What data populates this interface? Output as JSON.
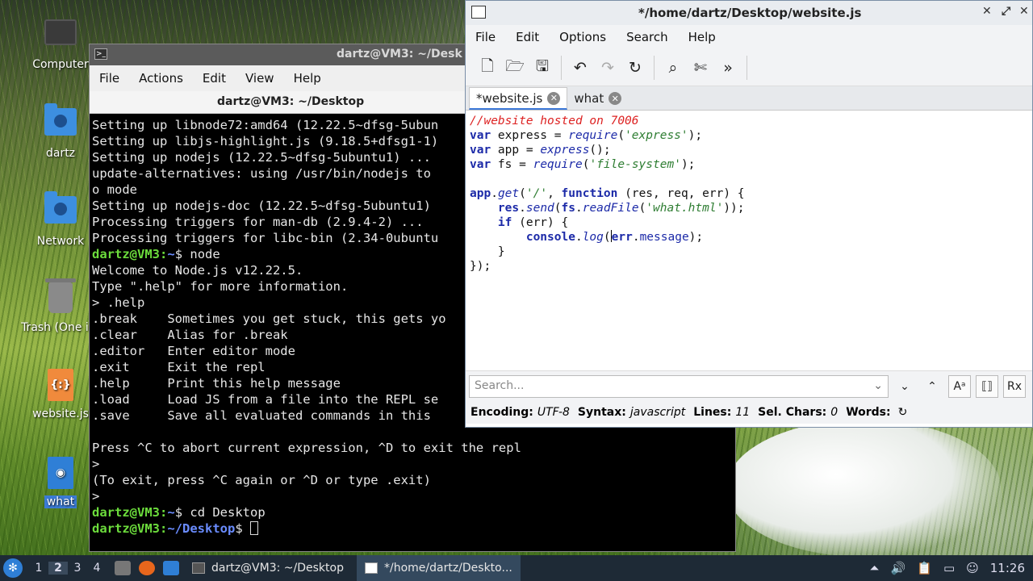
{
  "desktop": {
    "icons": [
      {
        "label": "Computer",
        "icon": "computer-icon"
      },
      {
        "label": "dartz",
        "icon": "home-folder-icon"
      },
      {
        "label": "Network",
        "icon": "network-icon"
      },
      {
        "label": "Trash (One ite",
        "icon": "trash-icon"
      },
      {
        "label": "website.js",
        "icon": "js-file-icon"
      },
      {
        "label": "what",
        "icon": "html-file-icon"
      }
    ]
  },
  "terminal": {
    "title": "dartz@VM3: ~/Desk",
    "tab_title": "dartz@VM3: ~/Desktop",
    "menu": [
      "File",
      "Actions",
      "Edit",
      "View",
      "Help"
    ],
    "lines": [
      "Setting up libnode72:amd64 (12.22.5~dfsg-5ubun",
      "Setting up libjs-highlight.js (9.18.5+dfsg1-1)",
      "Setting up nodejs (12.22.5~dfsg-5ubuntu1) ...",
      "update-alternatives: using /usr/bin/nodejs to ",
      "o mode",
      "Setting up nodejs-doc (12.22.5~dfsg-5ubuntu1)",
      "Processing triggers for man-db (2.9.4-2) ...",
      "Processing triggers for libc-bin (2.34-0ubuntu"
    ],
    "prompt_user": "dartz@VM3",
    "prompt_home": "~",
    "prompt_desktop": "~/Desktop",
    "cmd_node": "node",
    "node_lines": [
      "Welcome to Node.js v12.22.5.",
      "Type \".help\" for more information.",
      "> .help",
      ".break    Sometimes you get stuck, this gets yo",
      ".clear    Alias for .break",
      ".editor   Enter editor mode",
      ".exit     Exit the repl",
      ".help     Print this help message",
      ".load     Load JS from a file into the REPL se",
      ".save     Save all evaluated commands in this ",
      "",
      "Press ^C to abort current expression, ^D to exit the repl",
      ">",
      "(To exit, press ^C again or ^D or type .exit)",
      ">"
    ],
    "cmd_cd": "cd Desktop"
  },
  "editor": {
    "title": "*/home/dartz/Desktop/website.js",
    "menu": [
      "File",
      "Edit",
      "Options",
      "Search",
      "Help"
    ],
    "tabs": [
      "*website.js",
      "what"
    ],
    "code": {
      "l1": "//website hosted on 7006",
      "var": "var",
      "express_name": " express = ",
      "require": "require",
      "s_express": "'express'",
      "app_name": " app = ",
      "express_call": "express",
      "fs_name": " fs = ",
      "s_fs": "'file-system'",
      "app": "app",
      "get": "get",
      "s_root": "'/'",
      "function": "function",
      "args": " (res, req, err) {",
      "res": "res",
      "send": "send",
      "fs": "fs",
      "readFile": "readFile",
      "s_what": "'what.html'",
      "if": "if",
      "if_rest": " (err) {",
      "console": "console",
      "log": "log",
      "err": "err",
      "message": "message"
    },
    "search_placeholder": "Search...",
    "status": {
      "encoding_label": "Encoding:",
      "encoding": "UTF-8",
      "syntax_label": "Syntax:",
      "syntax": "javascript",
      "lines_label": "Lines:",
      "lines": "11",
      "sel_label": "Sel. Chars:",
      "sel": "0",
      "words_label": "Words:"
    }
  },
  "taskbar": {
    "workspaces": [
      "1",
      "2",
      "3",
      "4"
    ],
    "tasks": [
      "dartz@VM3: ~/Desktop",
      "*/home/dartz/Deskto..."
    ],
    "clock": "11:26"
  }
}
